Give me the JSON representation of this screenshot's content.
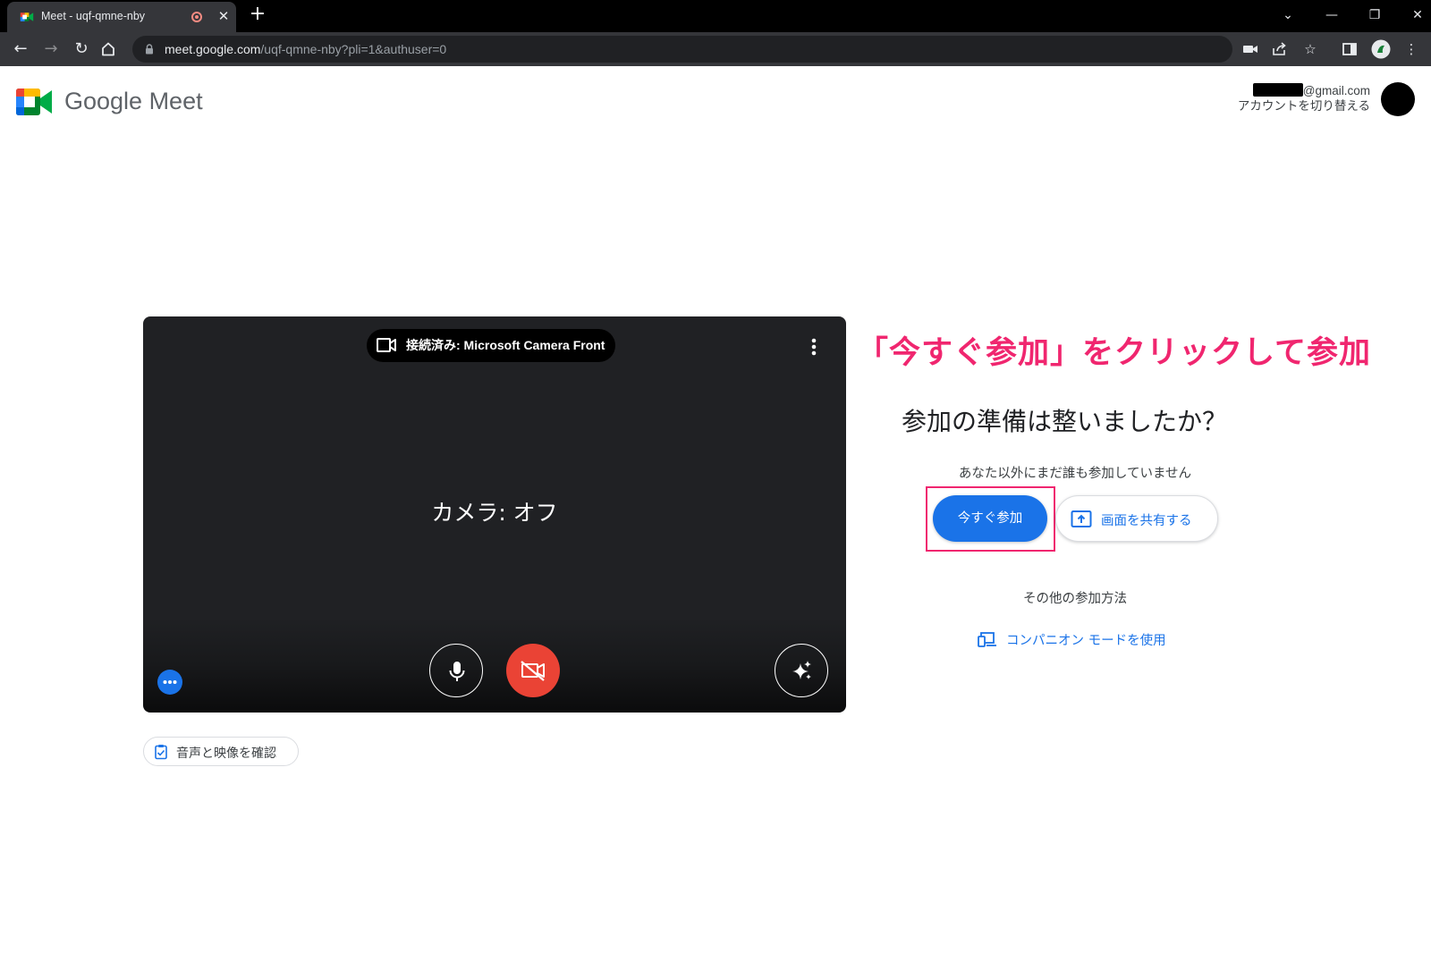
{
  "browser": {
    "tab_title": "Meet - uqf-qmne-nby",
    "url_host": "meet.google.com",
    "url_path": "/uqf-qmne-nby?pli=1&authuser=0"
  },
  "header": {
    "brand": "Google Meet",
    "account_email_suffix": "@gmail.com",
    "switch_account": "アカウントを切り替える"
  },
  "preview": {
    "camera_status": "接続済み: Microsoft Camera Front",
    "camera_off_text": "カメラ: オフ",
    "check_av_label": "音声と映像を確認"
  },
  "panel": {
    "annotation": "「今すぐ参加」をクリックして参加",
    "ready_title": "参加の準備は整いましたか？",
    "nobody_text": "あなた以外にまだ誰も参加していません",
    "join_label": "今すぐ参加",
    "present_label": "画面を共有する",
    "other_ways": "その他の参加方法",
    "companion_label": "コンパニオン モードを使用"
  },
  "icons": {
    "favicon": "google-meet-icon",
    "rec": "recording-indicator-icon",
    "camera": "videocam-icon",
    "mic": "mic-icon",
    "cam_off": "videocam-off-icon",
    "effects": "sparkle-icon",
    "more": "more-horizontal-icon",
    "present": "present-to-all-icon",
    "companion": "devices-icon"
  },
  "colors": {
    "meet_blue": "#1a73e8",
    "cam_off_red": "#ea4335",
    "annotation_pink": "#f0266f"
  }
}
